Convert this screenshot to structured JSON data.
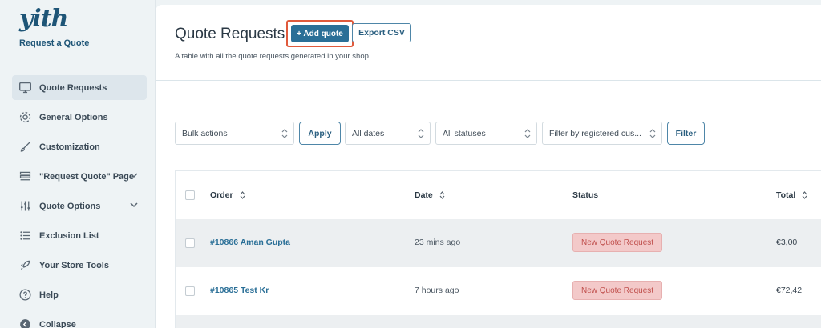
{
  "brand": {
    "logo": "yith",
    "subtitle": "Request a Quote"
  },
  "sidebar": {
    "items": [
      {
        "label": "Quote Requests",
        "icon": "monitor-icon",
        "active": true
      },
      {
        "label": "General Options",
        "icon": "gear-icon"
      },
      {
        "label": "Customization",
        "icon": "brush-icon"
      },
      {
        "label": "\"Request Quote\" Page",
        "icon": "stack-icon",
        "expandable": true
      },
      {
        "label": "Quote Options",
        "icon": "sliders-icon",
        "expandable": true
      },
      {
        "label": "Exclusion List",
        "icon": "list-icon"
      },
      {
        "label": "Your Store Tools",
        "icon": "rocket-icon"
      },
      {
        "label": "Help",
        "icon": "help-icon"
      },
      {
        "label": "Collapse",
        "icon": "collapse-icon"
      }
    ]
  },
  "header": {
    "title": "Quote Requests",
    "add_label": "+ Add quote",
    "export_label": "Export CSV",
    "description": "A table with all the quote requests generated in your shop."
  },
  "filters": {
    "bulk_actions": "Bulk actions",
    "apply_label": "Apply",
    "dates": "All dates",
    "statuses": "All statuses",
    "customer": "Filter by registered cus...",
    "filter_label": "Filter"
  },
  "table": {
    "columns": [
      "Order",
      "Date",
      "Status",
      "Total"
    ],
    "rows": [
      {
        "order": "#10866 Aman Gupta",
        "date": "23 mins ago",
        "status": "New Quote Request",
        "total": "€3,00"
      },
      {
        "order": "#10865 Test Kr",
        "date": "7 hours ago",
        "status": "New Quote Request",
        "total": "€72,42"
      }
    ]
  },
  "colors": {
    "primary": "#2a6f97",
    "highlight_border": "#e05a3c",
    "status_bg": "#f3c9c9",
    "status_text": "#c0504d",
    "sidebar_bg": "#eef3f5"
  }
}
